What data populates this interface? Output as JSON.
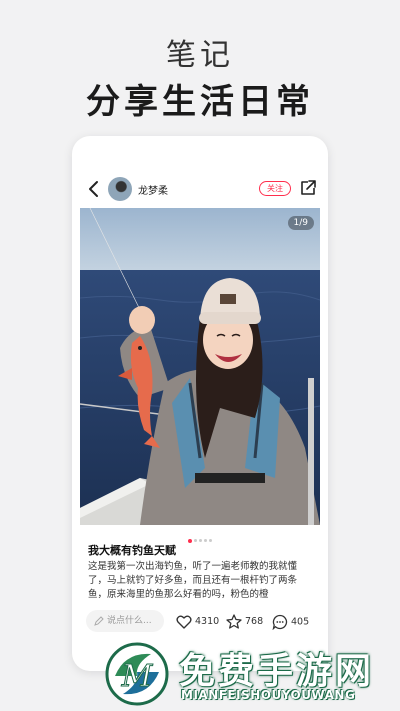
{
  "hero": {
    "subtitle": "笔记",
    "title": "分享生活日常"
  },
  "note": {
    "username": "龙梦柔",
    "follow_label": "关注",
    "page_indicator": "1/9",
    "image_count": 9,
    "current_image": 1,
    "title": "我大概有钓鱼天赋",
    "body": "这是我第一次出海钓鱼，听了一遍老师教的我就懂了，马上就钓了好多鱼，而且还有一根杆钓了两条鱼，原来海里的鱼那么好看的吗，粉色的橙",
    "comment_placeholder": "说点什么...",
    "likes": "4310",
    "favorites": "768",
    "comments": "405"
  },
  "watermark": {
    "name": "免费手游网",
    "pinyin": "MIANFEISHOUYOUWANG",
    "accent": "#1d6b4a"
  },
  "colors": {
    "brand_red": "#ff2e4d",
    "sea": "#2a4470",
    "sky": "#b7c9db"
  }
}
